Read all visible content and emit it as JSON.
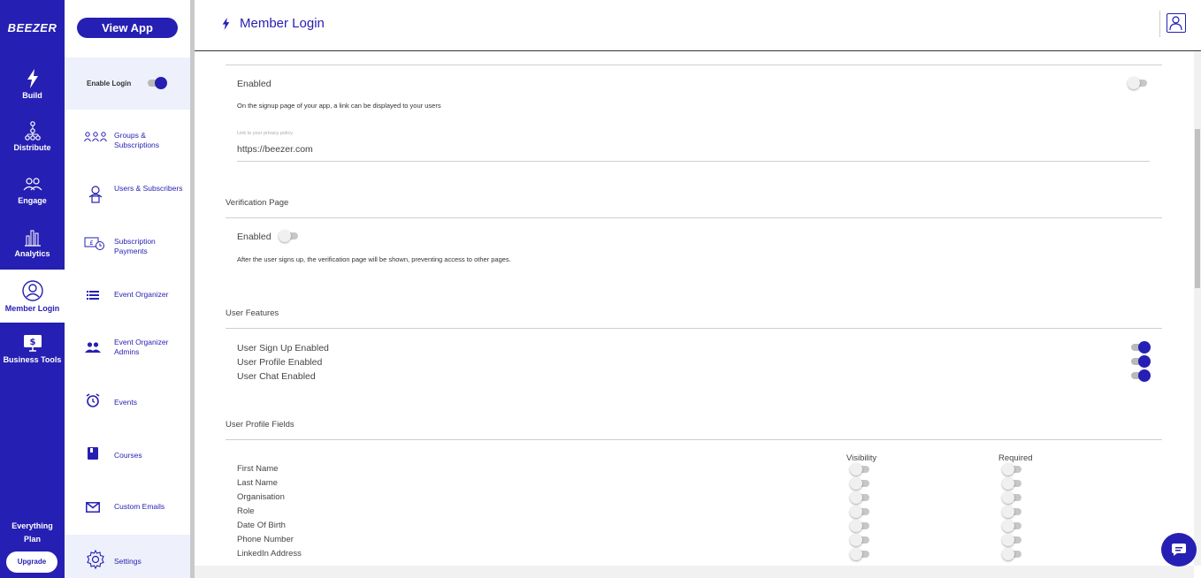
{
  "rail": {
    "logo": "BEEZER",
    "items": [
      {
        "label": "Build",
        "icon": "bolt-icon"
      },
      {
        "label": "Distribute",
        "icon": "hierarchy-icon"
      },
      {
        "label": "Engage",
        "icon": "group-icon"
      },
      {
        "label": "Analytics",
        "icon": "bar-chart-icon"
      },
      {
        "label": "Member Login",
        "icon": "user-circle-icon",
        "active": true
      },
      {
        "label": "Business Tools",
        "icon": "monitor-dollar-icon"
      }
    ],
    "plan_line1": "Everything",
    "plan_line2": "Plan",
    "upgrade": "Upgrade"
  },
  "sub": {
    "view_app": "View App",
    "enable_login": "Enable Login",
    "items": [
      {
        "label": "Groups & Subscriptions",
        "icon": "groups-icon"
      },
      {
        "label": "Users & Subscribers",
        "icon": "user-lock-icon"
      },
      {
        "label": "Subscription Payments",
        "icon": "payment-clock-icon"
      },
      {
        "label": "Event Organizer",
        "icon": "list-icon"
      },
      {
        "label": "Event Organizer Admins",
        "icon": "people-icon"
      },
      {
        "label": "Events",
        "icon": "alarm-icon"
      },
      {
        "label": "Courses",
        "icon": "book-icon"
      },
      {
        "label": "Custom Emails",
        "icon": "mail-icon"
      },
      {
        "label": "Settings",
        "icon": "gear-icon"
      }
    ]
  },
  "header": {
    "title": "Member Login"
  },
  "privacy": {
    "enabled_label": "Enabled",
    "description": "On the signup page of your app, a link can be displayed to your users",
    "link_label": "Link to your privacy policy",
    "link_value": "https://beezer.com"
  },
  "verification": {
    "title": "Verification Page",
    "enabled_label": "Enabled",
    "description": "After the user signs up, the verification page will be shown, preventing access to other pages."
  },
  "features": {
    "title": "User Features",
    "items": [
      {
        "label": "User Sign Up Enabled",
        "on": true
      },
      {
        "label": "User Profile Enabled",
        "on": true
      },
      {
        "label": "User Chat Enabled",
        "on": true
      }
    ]
  },
  "profile_fields": {
    "title": "User Profile Fields",
    "col_visibility": "Visibility",
    "col_required": "Required",
    "rows": [
      {
        "label": "First Name",
        "visible": false,
        "required": false
      },
      {
        "label": "Last Name",
        "visible": false,
        "required": false
      },
      {
        "label": "Organisation",
        "visible": false,
        "required": false
      },
      {
        "label": "Role",
        "visible": false,
        "required": false
      },
      {
        "label": "Date Of Birth",
        "visible": false,
        "required": false
      },
      {
        "label": "Phone Number",
        "visible": false,
        "required": false
      },
      {
        "label": "LinkedIn Address",
        "visible": false,
        "required": false
      }
    ]
  },
  "colors": {
    "brand": "#261fb3",
    "toggle_off": "#c7c7c7"
  }
}
